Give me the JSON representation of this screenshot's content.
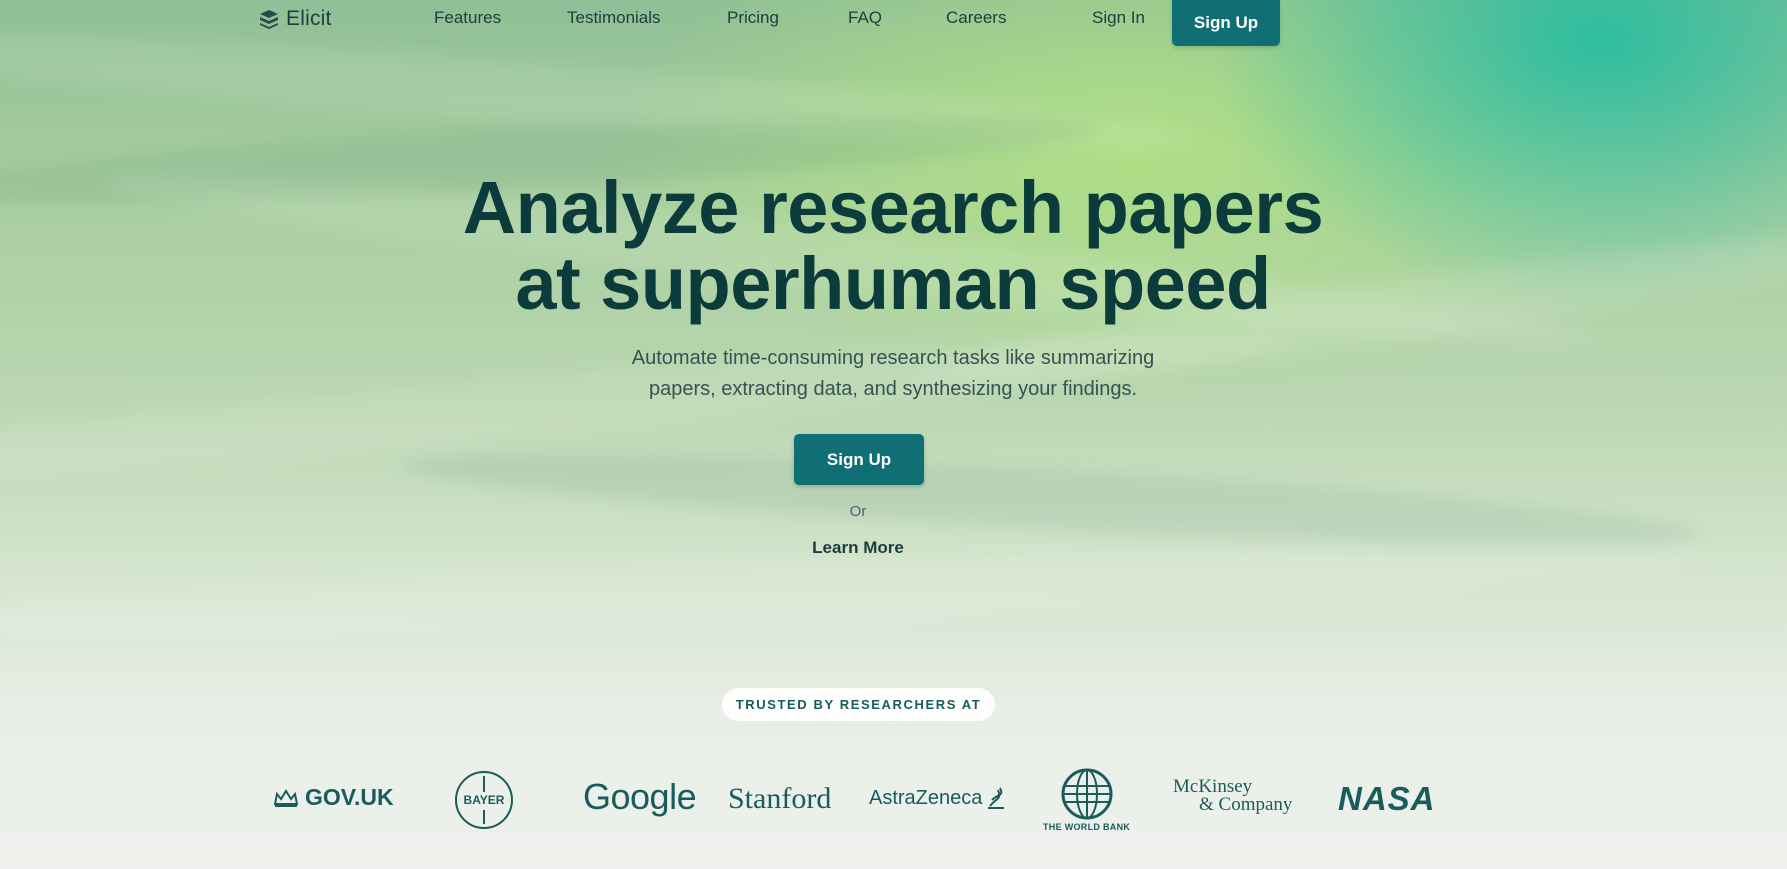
{
  "app": {
    "brand": "Elicit"
  },
  "nav": {
    "links": [
      {
        "label": "Features"
      },
      {
        "label": "Testimonials"
      },
      {
        "label": "Pricing"
      },
      {
        "label": "FAQ"
      },
      {
        "label": "Careers"
      },
      {
        "label": "Sign In"
      }
    ],
    "cta_label": "Sign Up"
  },
  "hero": {
    "title_line1": "Analyze research papers",
    "title_line2": "at superhuman speed",
    "subtitle_line1": "Automate time-consuming research tasks like summarizing",
    "subtitle_line2": "papers, extracting data, and synthesizing your findings.",
    "cta_label": "Sign Up",
    "or_text": "Or",
    "learn_more_label": "Learn More"
  },
  "trusted": {
    "badge": "TRUSTED BY RESEARCHERS AT",
    "logos": {
      "govuk": "GOV.UK",
      "bayer": "BAYER",
      "google": "Google",
      "stanford": "Stanford",
      "astrazeneca": "AstraZeneca",
      "worldbank": "THE WORLD BANK",
      "mckinsey_line1": "McKinsey",
      "mckinsey_line2": "& Company",
      "nasa": "NASA"
    }
  },
  "icons": {
    "brand_logo": "stacked-layers-icon",
    "govuk": "crown-icon",
    "bayer": "bayer-cross-icon",
    "astrazeneca": "astrazeneca-swirl-icon",
    "worldbank": "globe-icon"
  },
  "colors": {
    "primary": "#0f6f74",
    "heading": "#0b3b3b",
    "logo_teal": "#1a5c5c"
  }
}
